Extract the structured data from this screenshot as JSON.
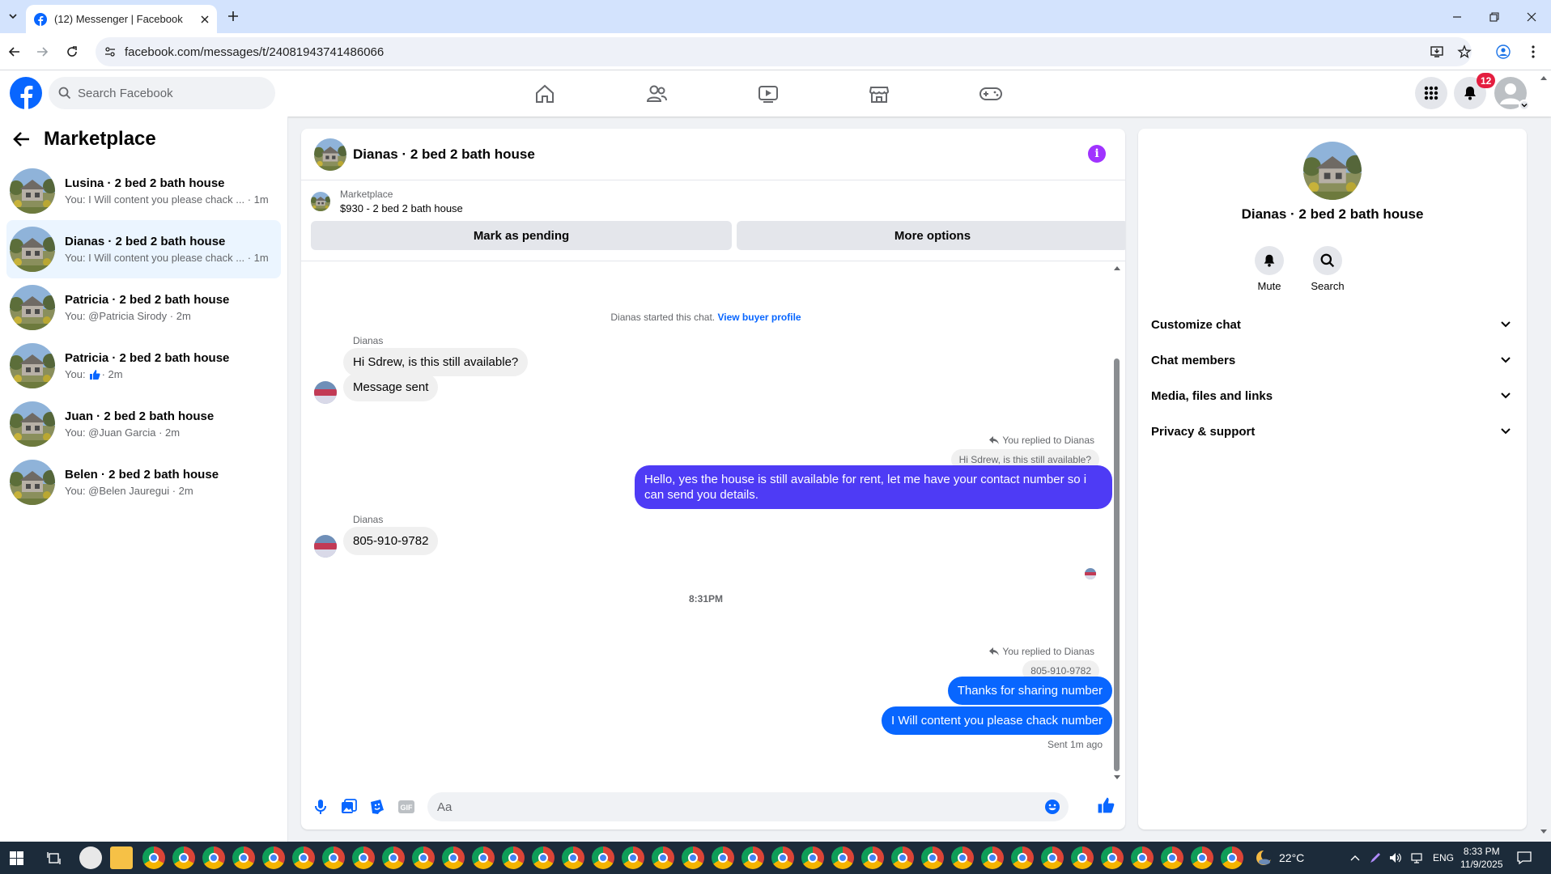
{
  "browser": {
    "tab_title": "(12) Messenger | Facebook",
    "url": "facebook.com/messages/t/24081943741486066"
  },
  "fb_header": {
    "search_placeholder": "Search Facebook",
    "notification_count": "12"
  },
  "sidebar": {
    "title": "Marketplace",
    "conversations": [
      {
        "name": "Lusina · 2 bed 2 bath house",
        "preview": "You: I Will content you please chack ...",
        "time": "· 1m"
      },
      {
        "name": "Dianas · 2 bed 2 bath house",
        "preview": "You: I Will content you please chack ...",
        "time": "· 1m"
      },
      {
        "name": "Patricia · 2 bed 2 bath house",
        "preview": "You: @Patricia Sirody",
        "time": "· 2m"
      },
      {
        "name": "Patricia · 2 bed 2 bath house",
        "preview": "You:",
        "time": "· 2m"
      },
      {
        "name": "Juan · 2 bed 2 bath house",
        "preview": "You: @Juan Garcia",
        "time": "· 2m"
      },
      {
        "name": "Belen · 2 bed 2 bath house",
        "preview": "You: @Belen Jauregui",
        "time": "· 2m"
      }
    ]
  },
  "chat": {
    "title": "Dianas · 2 bed 2 bath house",
    "listing_label": "Marketplace",
    "listing_price": "$930 - 2 bed 2 bath house",
    "mark_pending": "Mark as pending",
    "more_options": "More options",
    "started_text": "Dianas started this chat.",
    "view_profile": "View buyer profile",
    "sender1": "Dianas",
    "msg1": "Hi Sdrew, is this still available?",
    "msg2": "Message sent",
    "reply_note1": "You replied to Dianas",
    "quoted1": "Hi Sdrew, is this still available?",
    "out1": "Hello, yes the house is still available for rent, let me have your contact number so i can send you details.",
    "sender2": "Dianas",
    "msg3": "805-910-9782",
    "time_divider": "8:31PM",
    "reply_note2": "You replied to Dianas",
    "quoted2": "805-910-9782",
    "out2": "Thanks for sharing number",
    "out3": "I Will content you please chack number",
    "sent_status": "Sent 1m ago",
    "composer_placeholder": "Aa"
  },
  "info_panel": {
    "name": "Dianas · 2 bed 2 bath house",
    "mute": "Mute",
    "search": "Search",
    "sections": [
      "Customize chat",
      "Chat members",
      "Media, files and links",
      "Privacy & support"
    ]
  },
  "taskbar": {
    "weather": "22°C",
    "lang": "ENG",
    "time": "8:33 PM",
    "date": "11/9/2025"
  },
  "colors": {
    "fb_blue": "#0866ff",
    "purple_bubble": "#4e3bf5",
    "info_purple": "#a033ff"
  }
}
